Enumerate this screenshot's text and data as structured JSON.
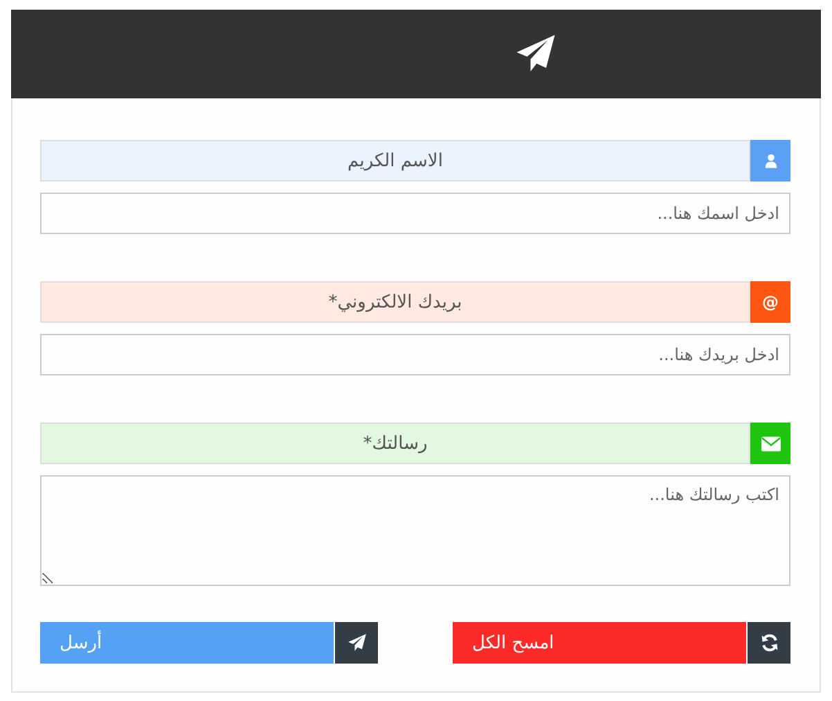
{
  "header": {
    "kind": "plane"
  },
  "fields": [
    {
      "label": "الاسم الكريم",
      "kind": "user",
      "color": "#5aa0f5",
      "multiline": false,
      "placeholder": "ادخل اسمك هنا..."
    },
    {
      "label": "بريدك الالكتروني*",
      "kind": "at",
      "glyph": "@",
      "color": "#fd5512",
      "multiline": false,
      "placeholder": "ادخل بريدك هنا..."
    },
    {
      "label": "رسالتك*",
      "kind": "envelope",
      "color": "#1ec60f",
      "multiline": true,
      "placeholder": "اكتب رسالتك هنا..."
    }
  ],
  "buttons": [
    {
      "kind": "reset",
      "label": "امسح الكل",
      "color": "#fd2a2a"
    },
    {
      "kind": "send",
      "label": "أرسل",
      "color": "#55a1f5"
    }
  ]
}
